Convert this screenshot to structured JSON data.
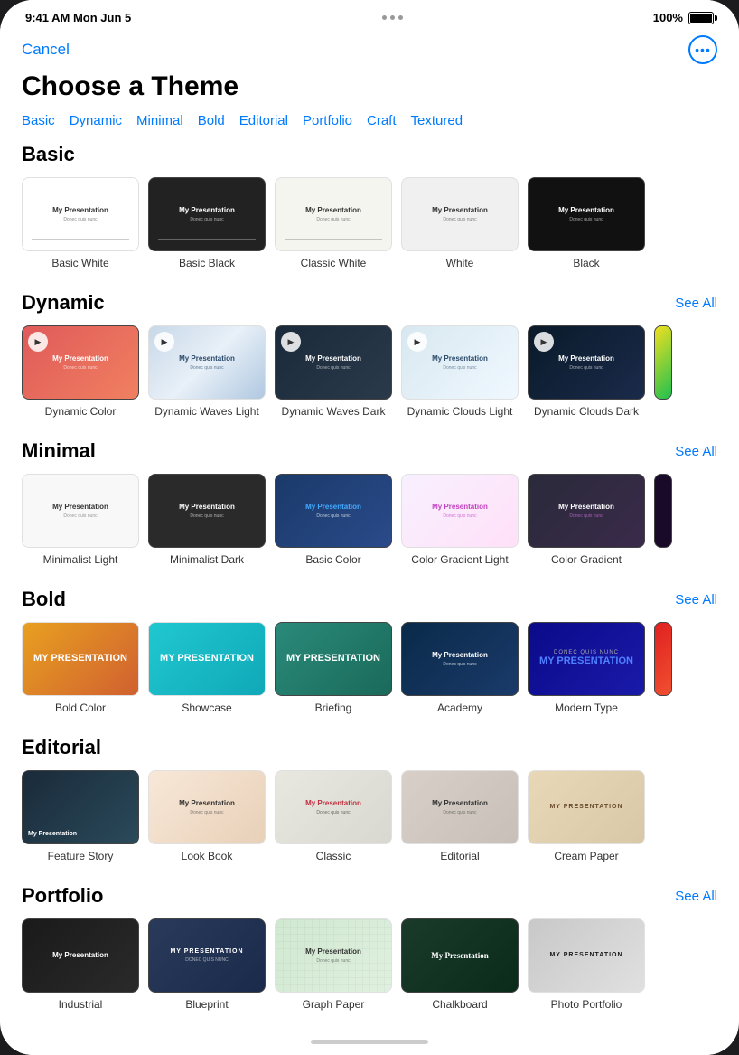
{
  "statusBar": {
    "time": "9:41 AM  Mon Jun 5",
    "battery": "100%"
  },
  "header": {
    "cancelLabel": "Cancel",
    "pageTitle": "Choose a Theme"
  },
  "categoryTabs": {
    "items": [
      {
        "label": "Basic"
      },
      {
        "label": "Dynamic"
      },
      {
        "label": "Minimal"
      },
      {
        "label": "Bold"
      },
      {
        "label": "Editorial"
      },
      {
        "label": "Portfolio"
      },
      {
        "label": "Craft"
      },
      {
        "label": "Textured"
      }
    ]
  },
  "sections": {
    "basic": {
      "title": "Basic",
      "themes": [
        {
          "name": "Basic White",
          "thumb": "basic-white",
          "dark": false
        },
        {
          "name": "Basic Black",
          "thumb": "basic-black",
          "dark": true
        },
        {
          "name": "Classic White",
          "thumb": "classic-white",
          "dark": false
        },
        {
          "name": "White",
          "thumb": "white",
          "dark": false
        },
        {
          "name": "Black",
          "thumb": "black",
          "dark": true
        }
      ]
    },
    "dynamic": {
      "title": "Dynamic",
      "seeAll": "See All",
      "themes": [
        {
          "name": "Dynamic Color",
          "thumb": "dynamic-color",
          "dark": true,
          "hasPlay": true
        },
        {
          "name": "Dynamic Waves Light",
          "thumb": "dynamic-waves-light",
          "dark": false,
          "hasPlay": true
        },
        {
          "name": "Dynamic Waves Dark",
          "thumb": "dynamic-waves-dark",
          "dark": true,
          "hasPlay": true
        },
        {
          "name": "Dynamic Clouds Light",
          "thumb": "dynamic-clouds-light",
          "dark": false,
          "hasPlay": true
        },
        {
          "name": "Dynamic Clouds Dark",
          "thumb": "dynamic-clouds-dark",
          "dark": true,
          "hasPlay": true
        },
        {
          "name": "...",
          "thumb": "dynamic-extra",
          "dark": true,
          "hasPlay": true
        }
      ]
    },
    "minimal": {
      "title": "Minimal",
      "seeAll": "See All",
      "themes": [
        {
          "name": "Minimalist Light",
          "thumb": "minimalist-light",
          "dark": false
        },
        {
          "name": "Minimalist Dark",
          "thumb": "minimalist-dark",
          "dark": true
        },
        {
          "name": "Basic Color",
          "thumb": "basic-color",
          "dark": true
        },
        {
          "name": "Color Gradient Light",
          "thumb": "color-gradient-light",
          "dark": false
        },
        {
          "name": "Color Gradient",
          "thumb": "color-gradient",
          "dark": true
        },
        {
          "name": "...",
          "thumb": "dark-extra",
          "dark": true
        }
      ]
    },
    "bold": {
      "title": "Bold",
      "seeAll": "See All",
      "themes": [
        {
          "name": "Bold Color",
          "thumb": "bold-color",
          "dark": false
        },
        {
          "name": "Showcase",
          "thumb": "showcase",
          "dark": false
        },
        {
          "name": "Briefing",
          "thumb": "briefing",
          "dark": true
        },
        {
          "name": "Academy",
          "thumb": "academy",
          "dark": true
        },
        {
          "name": "Modern Type",
          "thumb": "modern-type",
          "dark": true
        },
        {
          "name": "...",
          "thumb": "bold-extra",
          "dark": true
        }
      ]
    },
    "editorial": {
      "title": "Editorial",
      "themes": [
        {
          "name": "Feature Story",
          "thumb": "feature-story",
          "dark": true
        },
        {
          "name": "Look Book",
          "thumb": "look-book",
          "dark": false
        },
        {
          "name": "Classic",
          "thumb": "classic",
          "dark": false
        },
        {
          "name": "Editorial",
          "thumb": "editorial",
          "dark": false
        },
        {
          "name": "Cream Paper",
          "thumb": "cream-paper",
          "dark": false
        }
      ]
    },
    "portfolio": {
      "title": "Portfolio",
      "seeAll": "See All",
      "themes": [
        {
          "name": "Industrial",
          "thumb": "industrial",
          "dark": true
        },
        {
          "name": "Blueprint",
          "thumb": "blueprint",
          "dark": true
        },
        {
          "name": "Graph Paper",
          "thumb": "graph-paper",
          "dark": false
        },
        {
          "name": "Chalkboard",
          "thumb": "chalkboard",
          "dark": true
        },
        {
          "name": "Photo Portfolio",
          "thumb": "photo-portfolio",
          "dark": false
        }
      ]
    }
  }
}
